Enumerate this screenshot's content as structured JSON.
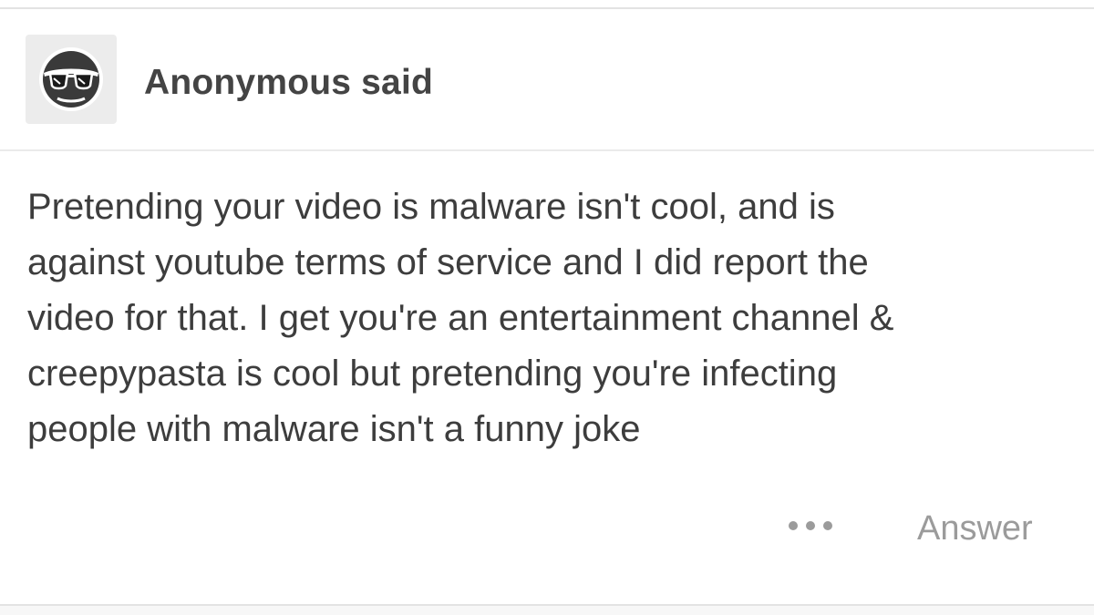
{
  "header": {
    "avatar_icon": "anonymous-sunglasses-icon",
    "asker_label": "Anonymous said"
  },
  "question": {
    "lines": [
      "Pretending your video is malware isn't cool, and is",
      "against youtube terms of service and I did report the",
      "video for that. I get you're an entertainment channel &",
      "creepypasta is cool but pretending you're infecting",
      "people with malware isn't a funny joke"
    ]
  },
  "footer": {
    "more_icon": "more-dots-icon",
    "answer_label": "Answer"
  },
  "colors": {
    "text": "#3d3d3d",
    "muted": "#9b9b9b",
    "divider": "#e3e3e3",
    "avatar_bg": "#ececec"
  }
}
